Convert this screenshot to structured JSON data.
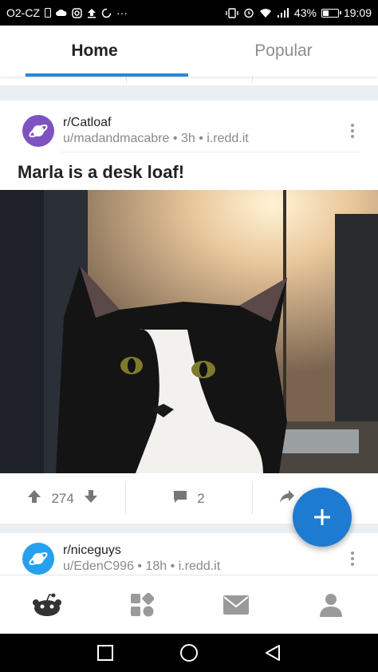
{
  "status_bar": {
    "carrier": "O2-CZ",
    "battery_percent": "43%",
    "battery_level": 0.43,
    "time": "19:09",
    "icons": [
      "sim-icon",
      "cloud-icon",
      "instagram-icon",
      "upload-icon",
      "sync-icon",
      "more-notifications-icon",
      "vibrate-icon",
      "alarm-icon",
      "wifi-icon",
      "signal-icon",
      "battery-icon"
    ],
    "overflow": "···"
  },
  "tabs": [
    {
      "label": "Home",
      "active": true
    },
    {
      "label": "Popular",
      "active": false
    }
  ],
  "posts": [
    {
      "subreddit": "r/Catloaf",
      "user": "u/madandmacabre",
      "age": "3h",
      "domain": "i.redd.it",
      "separator": "•",
      "title": "Marla is a desk loaf!",
      "avatar_color": "#7e53c1",
      "upvotes": "274",
      "comments": "2"
    },
    {
      "subreddit": "r/niceguys",
      "user": "u/EdenC996",
      "age": "18h",
      "domain": "i.redd.it",
      "separator": "•",
      "avatar_color": "#24a0ed"
    }
  ],
  "fab": {
    "icon": "plus-icon",
    "color": "#1d7bd1"
  },
  "bottom_nav": [
    "home-snoo-icon",
    "communities-icon",
    "inbox-icon",
    "profile-icon"
  ],
  "system_nav": [
    "recents-icon",
    "home-circle-icon",
    "back-icon"
  ],
  "colors": {
    "accent": "#2a87d8",
    "text": "#222222",
    "muted": "#8a8a8a"
  }
}
